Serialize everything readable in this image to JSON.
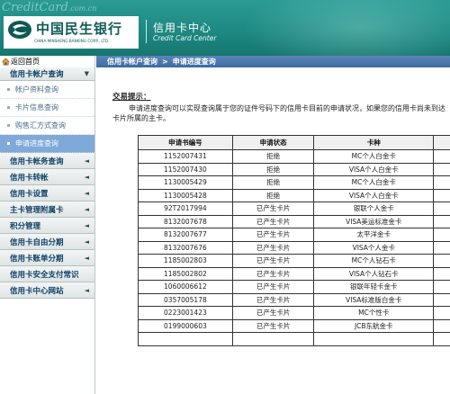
{
  "header": {
    "watermark": "CreditCard",
    "watermark_suffix": ".com.cn",
    "bank_name_cn": "中国民生银行",
    "bank_name_en": "CHINA MINSHENG BANKING CORP., LTD.",
    "section_cn": "信用卡中心",
    "section_en": "Credit Card Center"
  },
  "sidebar": {
    "home": "返回首页",
    "account_section": "信用卡帐户查询",
    "sub_items": [
      "帐户资料查询",
      "卡片信息查询",
      "购售汇方式查询",
      "申请进度查询"
    ],
    "active_sub": "申请进度查询",
    "items": [
      "信用卡帐务查询",
      "信用卡转帐",
      "信用卡设置",
      "主卡管理附属卡",
      "积分管理",
      "信用卡自由分期",
      "信用卡账单分期",
      "信用卡安全支付常识",
      "信用卡中心网站"
    ]
  },
  "breadcrumb": {
    "part1": "信用卡帐户查询",
    "separator": ">",
    "part2": "申请进度查询"
  },
  "tip": {
    "title": "交易提示：",
    "text": "申请进度查询可以实现查询属于您的证件号码下的信用卡目前的申请状况，如果您的信用卡尚未到达卡片所属的主卡。"
  },
  "table": {
    "headers": [
      "申请书编号",
      "申请状态",
      "卡种",
      ""
    ],
    "rows": [
      [
        "1152007431",
        "拒绝",
        "MC个人白金卡"
      ],
      [
        "1152007430",
        "拒绝",
        "VISA个人白金卡"
      ],
      [
        "1130005429",
        "拒绝",
        "MC个人白金卡"
      ],
      [
        "1130005428",
        "拒绝",
        "VISA个人白金卡"
      ],
      [
        "92T2017994",
        "已产生卡片",
        "银联个人金卡"
      ],
      [
        "8132007678",
        "已产生卡片",
        "VISA美运标准金卡"
      ],
      [
        "8132007677",
        "已产生卡片",
        "太平洋金卡"
      ],
      [
        "8132007676",
        "已产生卡片",
        "VISA个人金卡"
      ],
      [
        "1185002803",
        "已产生卡片",
        "MC个人钻石卡"
      ],
      [
        "1185002802",
        "已产生卡片",
        "VISA个人钻石卡"
      ],
      [
        "1060006612",
        "已产生卡片",
        "银联年轻卡金卡"
      ],
      [
        "0357005178",
        "已产生卡片",
        "VISA标准版白金卡"
      ],
      [
        "0223001423",
        "已产生卡片",
        "MC个性卡"
      ],
      [
        "0199000603",
        "已产生卡片",
        "JCB东航金卡"
      ],
      [
        "",
        "",
        ""
      ]
    ]
  },
  "colors": {
    "banner": "#1d8780",
    "breadcrumb_bar": "#3d6aa1",
    "active_menu": "#7fa9d9",
    "menu_text": "#0c3f66"
  }
}
